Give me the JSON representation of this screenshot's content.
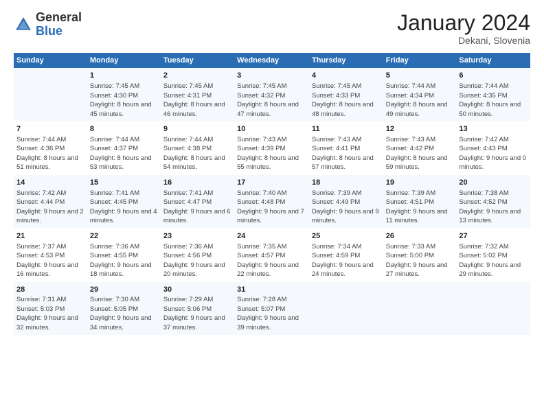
{
  "logo": {
    "general": "General",
    "blue": "Blue"
  },
  "header": {
    "month": "January 2024",
    "location": "Dekani, Slovenia"
  },
  "weekdays": [
    "Sunday",
    "Monday",
    "Tuesday",
    "Wednesday",
    "Thursday",
    "Friday",
    "Saturday"
  ],
  "weeks": [
    [
      {
        "day": "",
        "sunrise": "",
        "sunset": "",
        "daylight": ""
      },
      {
        "day": "1",
        "sunrise": "Sunrise: 7:45 AM",
        "sunset": "Sunset: 4:30 PM",
        "daylight": "Daylight: 8 hours and 45 minutes."
      },
      {
        "day": "2",
        "sunrise": "Sunrise: 7:45 AM",
        "sunset": "Sunset: 4:31 PM",
        "daylight": "Daylight: 8 hours and 46 minutes."
      },
      {
        "day": "3",
        "sunrise": "Sunrise: 7:45 AM",
        "sunset": "Sunset: 4:32 PM",
        "daylight": "Daylight: 8 hours and 47 minutes."
      },
      {
        "day": "4",
        "sunrise": "Sunrise: 7:45 AM",
        "sunset": "Sunset: 4:33 PM",
        "daylight": "Daylight: 8 hours and 48 minutes."
      },
      {
        "day": "5",
        "sunrise": "Sunrise: 7:44 AM",
        "sunset": "Sunset: 4:34 PM",
        "daylight": "Daylight: 8 hours and 49 minutes."
      },
      {
        "day": "6",
        "sunrise": "Sunrise: 7:44 AM",
        "sunset": "Sunset: 4:35 PM",
        "daylight": "Daylight: 8 hours and 50 minutes."
      }
    ],
    [
      {
        "day": "7",
        "sunrise": "Sunrise: 7:44 AM",
        "sunset": "Sunset: 4:36 PM",
        "daylight": "Daylight: 8 hours and 51 minutes."
      },
      {
        "day": "8",
        "sunrise": "Sunrise: 7:44 AM",
        "sunset": "Sunset: 4:37 PM",
        "daylight": "Daylight: 8 hours and 53 minutes."
      },
      {
        "day": "9",
        "sunrise": "Sunrise: 7:44 AM",
        "sunset": "Sunset: 4:38 PM",
        "daylight": "Daylight: 8 hours and 54 minutes."
      },
      {
        "day": "10",
        "sunrise": "Sunrise: 7:43 AM",
        "sunset": "Sunset: 4:39 PM",
        "daylight": "Daylight: 8 hours and 55 minutes."
      },
      {
        "day": "11",
        "sunrise": "Sunrise: 7:43 AM",
        "sunset": "Sunset: 4:41 PM",
        "daylight": "Daylight: 8 hours and 57 minutes."
      },
      {
        "day": "12",
        "sunrise": "Sunrise: 7:43 AM",
        "sunset": "Sunset: 4:42 PM",
        "daylight": "Daylight: 8 hours and 59 minutes."
      },
      {
        "day": "13",
        "sunrise": "Sunrise: 7:42 AM",
        "sunset": "Sunset: 4:43 PM",
        "daylight": "Daylight: 9 hours and 0 minutes."
      }
    ],
    [
      {
        "day": "14",
        "sunrise": "Sunrise: 7:42 AM",
        "sunset": "Sunset: 4:44 PM",
        "daylight": "Daylight: 9 hours and 2 minutes."
      },
      {
        "day": "15",
        "sunrise": "Sunrise: 7:41 AM",
        "sunset": "Sunset: 4:45 PM",
        "daylight": "Daylight: 9 hours and 4 minutes."
      },
      {
        "day": "16",
        "sunrise": "Sunrise: 7:41 AM",
        "sunset": "Sunset: 4:47 PM",
        "daylight": "Daylight: 9 hours and 6 minutes."
      },
      {
        "day": "17",
        "sunrise": "Sunrise: 7:40 AM",
        "sunset": "Sunset: 4:48 PM",
        "daylight": "Daylight: 9 hours and 7 minutes."
      },
      {
        "day": "18",
        "sunrise": "Sunrise: 7:39 AM",
        "sunset": "Sunset: 4:49 PM",
        "daylight": "Daylight: 9 hours and 9 minutes."
      },
      {
        "day": "19",
        "sunrise": "Sunrise: 7:39 AM",
        "sunset": "Sunset: 4:51 PM",
        "daylight": "Daylight: 9 hours and 11 minutes."
      },
      {
        "day": "20",
        "sunrise": "Sunrise: 7:38 AM",
        "sunset": "Sunset: 4:52 PM",
        "daylight": "Daylight: 9 hours and 13 minutes."
      }
    ],
    [
      {
        "day": "21",
        "sunrise": "Sunrise: 7:37 AM",
        "sunset": "Sunset: 4:53 PM",
        "daylight": "Daylight: 9 hours and 16 minutes."
      },
      {
        "day": "22",
        "sunrise": "Sunrise: 7:36 AM",
        "sunset": "Sunset: 4:55 PM",
        "daylight": "Daylight: 9 hours and 18 minutes."
      },
      {
        "day": "23",
        "sunrise": "Sunrise: 7:36 AM",
        "sunset": "Sunset: 4:56 PM",
        "daylight": "Daylight: 9 hours and 20 minutes."
      },
      {
        "day": "24",
        "sunrise": "Sunrise: 7:35 AM",
        "sunset": "Sunset: 4:57 PM",
        "daylight": "Daylight: 9 hours and 22 minutes."
      },
      {
        "day": "25",
        "sunrise": "Sunrise: 7:34 AM",
        "sunset": "Sunset: 4:59 PM",
        "daylight": "Daylight: 9 hours and 24 minutes."
      },
      {
        "day": "26",
        "sunrise": "Sunrise: 7:33 AM",
        "sunset": "Sunset: 5:00 PM",
        "daylight": "Daylight: 9 hours and 27 minutes."
      },
      {
        "day": "27",
        "sunrise": "Sunrise: 7:32 AM",
        "sunset": "Sunset: 5:02 PM",
        "daylight": "Daylight: 9 hours and 29 minutes."
      }
    ],
    [
      {
        "day": "28",
        "sunrise": "Sunrise: 7:31 AM",
        "sunset": "Sunset: 5:03 PM",
        "daylight": "Daylight: 9 hours and 32 minutes."
      },
      {
        "day": "29",
        "sunrise": "Sunrise: 7:30 AM",
        "sunset": "Sunset: 5:05 PM",
        "daylight": "Daylight: 9 hours and 34 minutes."
      },
      {
        "day": "30",
        "sunrise": "Sunrise: 7:29 AM",
        "sunset": "Sunset: 5:06 PM",
        "daylight": "Daylight: 9 hours and 37 minutes."
      },
      {
        "day": "31",
        "sunrise": "Sunrise: 7:28 AM",
        "sunset": "Sunset: 5:07 PM",
        "daylight": "Daylight: 9 hours and 39 minutes."
      },
      {
        "day": "",
        "sunrise": "",
        "sunset": "",
        "daylight": ""
      },
      {
        "day": "",
        "sunrise": "",
        "sunset": "",
        "daylight": ""
      },
      {
        "day": "",
        "sunrise": "",
        "sunset": "",
        "daylight": ""
      }
    ]
  ]
}
